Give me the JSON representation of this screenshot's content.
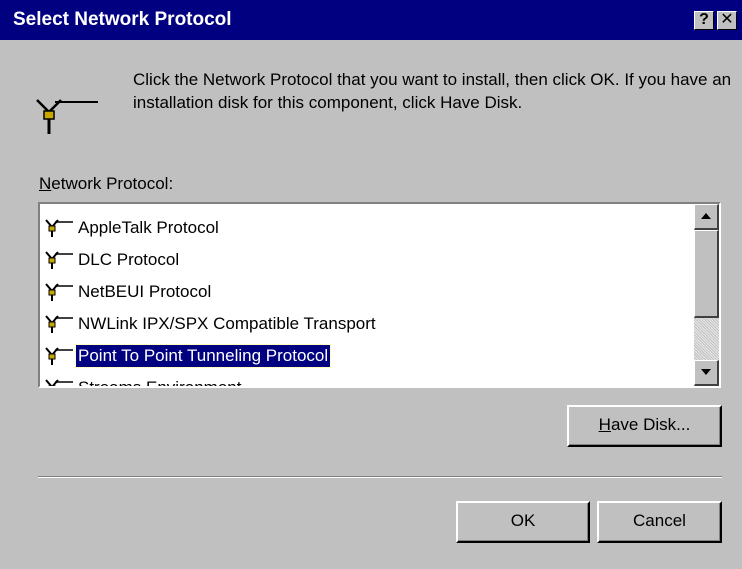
{
  "window": {
    "title": "Select Network Protocol",
    "help_button": "?",
    "close_button": "✕"
  },
  "instructions": "Click the Network Protocol that you want to install, then click OK.  If you have an installation disk for this component, click Have Disk.",
  "list": {
    "label_accel": "N",
    "label_rest": "etwork Protocol:",
    "items": [
      {
        "label": "AppleTalk Protocol",
        "icon": "protocol-icon"
      },
      {
        "label": "DLC Protocol",
        "icon": "protocol-icon"
      },
      {
        "label": "NetBEUI Protocol",
        "icon": "protocol-icon"
      },
      {
        "label": "NWLink IPX/SPX Compatible Transport",
        "icon": "protocol-icon"
      },
      {
        "label": "Point To Point Tunneling Protocol",
        "icon": "protocol-icon",
        "selected": true
      },
      {
        "label": "Streams Environment",
        "icon": "protocol-icon"
      }
    ]
  },
  "buttons": {
    "have_disk_accel": "H",
    "have_disk_rest": "ave Disk...",
    "ok": "OK",
    "cancel": "Cancel"
  },
  "colors": {
    "face": "#c0c0c0",
    "titlebar": "#000080",
    "selection": "#000080"
  }
}
